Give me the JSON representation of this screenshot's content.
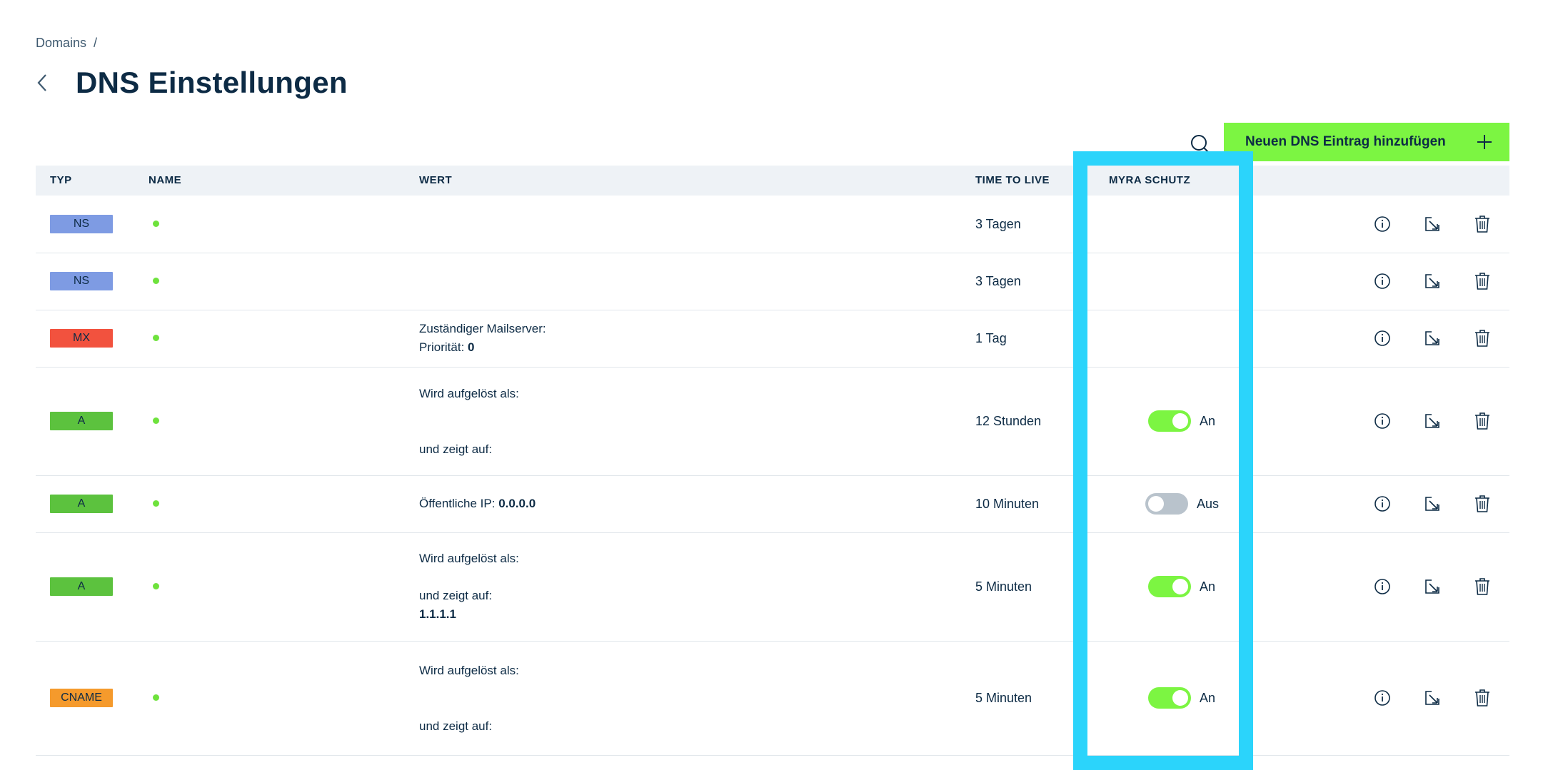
{
  "breadcrumb": {
    "item": "Domains",
    "separator": "/"
  },
  "page_title": "DNS Einstellungen",
  "toolbar": {
    "add_label": "Neuen DNS Eintrag hinzufügen"
  },
  "table": {
    "headers": {
      "typ": "TYP",
      "name": "NAME",
      "wert": "WERT",
      "ttl": "TIME TO LIVE",
      "myra": "MYRA SCHUTZ"
    },
    "rows": [
      {
        "type": "NS",
        "type_color": "#7e9be3",
        "value_lines": [],
        "ttl": "3 Tagen",
        "protection": null
      },
      {
        "type": "NS",
        "type_color": "#7e9be3",
        "value_lines": [],
        "ttl": "3 Tagen",
        "protection": null
      },
      {
        "type": "MX",
        "type_color": "#f2523e",
        "value_lines": [
          {
            "label": "Zuständiger Mailserver:",
            "value": ""
          },
          {
            "label": "Priorität:",
            "value": "0"
          }
        ],
        "ttl": "1 Tag",
        "protection": null
      },
      {
        "type": "A",
        "type_color": "#5cc23e",
        "value_lines": [
          {
            "label": "Wird aufgelöst als:",
            "value": ""
          },
          {
            "label": "",
            "value": ""
          },
          {
            "label": "und zeigt auf:",
            "value": ""
          }
        ],
        "ttl": "12 Stunden",
        "protection": {
          "state": "on",
          "label": "An"
        }
      },
      {
        "type": "A",
        "type_color": "#5cc23e",
        "value_lines": [
          {
            "label": "Öffentliche IP:",
            "value": "0.0.0.0"
          }
        ],
        "ttl": "10 Minuten",
        "protection": {
          "state": "off",
          "label": "Aus"
        }
      },
      {
        "type": "A",
        "type_color": "#5cc23e",
        "value_lines": [
          {
            "label": "Wird aufgelöst als:",
            "value": ""
          },
          {
            "label": "",
            "value": ""
          },
          {
            "label": "und zeigt auf:",
            "value": ""
          },
          {
            "label": "",
            "value": "1.1.1.1"
          }
        ],
        "ttl": "5 Minuten",
        "protection": {
          "state": "on",
          "label": "An"
        }
      },
      {
        "type": "CNAME",
        "type_color": "#f59a2c",
        "value_lines": [
          {
            "label": "Wird aufgelöst als:",
            "value": ""
          },
          {
            "label": "",
            "value": ""
          },
          {
            "label": "und zeigt auf:",
            "value": ""
          }
        ],
        "ttl": "5 Minuten",
        "protection": {
          "state": "on",
          "label": "An"
        }
      }
    ]
  },
  "icons": {
    "back": "chevron-left-icon",
    "search": "search-icon",
    "add": "plus-icon",
    "info": "info-icon",
    "edit": "edit-icon",
    "delete": "trash-icon"
  },
  "colors": {
    "accent_green": "#7cf542",
    "highlight": "#2bd4fb",
    "text": "#0d2b45"
  }
}
